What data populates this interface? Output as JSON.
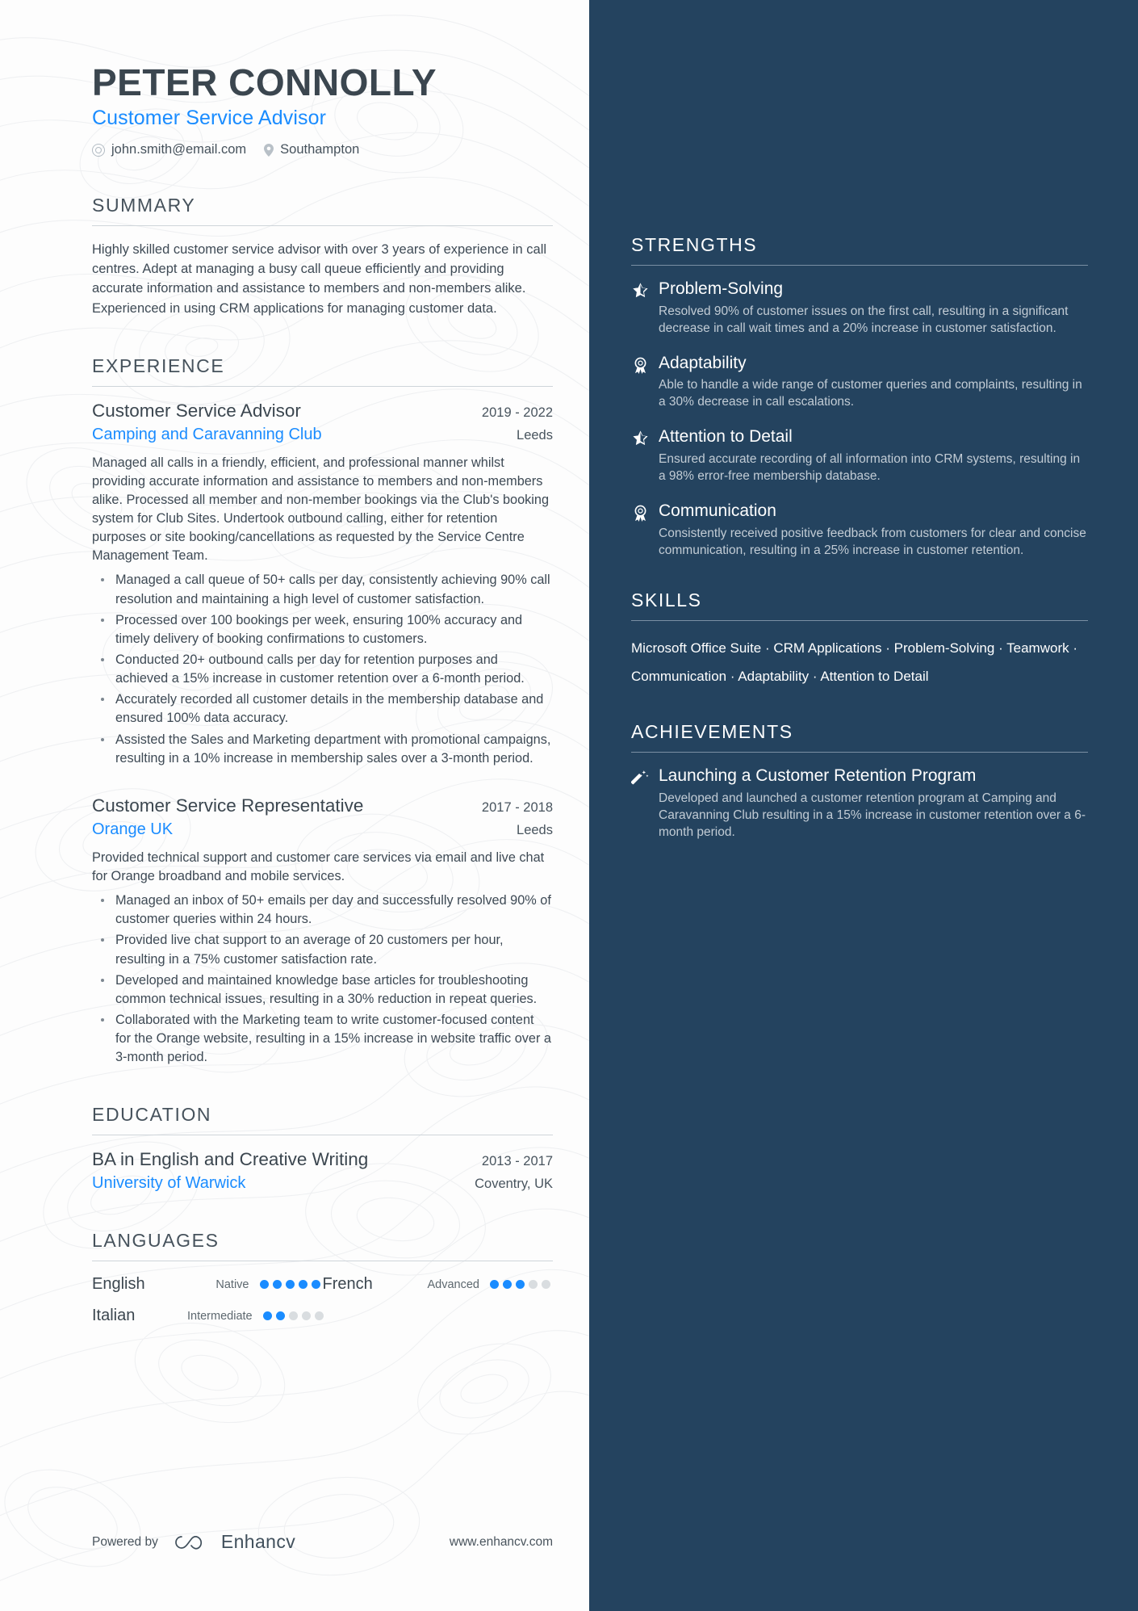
{
  "header": {
    "name": "PETER CONNOLLY",
    "role": "Customer Service Advisor",
    "email": "john.smith@email.com",
    "location": "Southampton",
    "email_icon": "at-icon",
    "location_icon": "map-pin-icon"
  },
  "colors": {
    "accent_blue": "#1a8cff",
    "sidebar_navy": "#24435f",
    "text_dark": "#3b464f"
  },
  "summary": {
    "heading": "SUMMARY",
    "text": "Highly skilled customer service advisor with over 3 years of experience in call centres. Adept at managing a busy call queue efficiently and providing accurate information and assistance to members and non-members alike. Experienced in using CRM applications for managing customer data."
  },
  "experience": {
    "heading": "EXPERIENCE",
    "jobs": [
      {
        "title": "Customer Service Advisor",
        "date": "2019 - 2022",
        "company": "Camping and Caravanning Club",
        "location": "Leeds",
        "description": "Managed all calls in a friendly, efficient, and professional manner whilst providing accurate information and assistance to members and non-members alike. Processed all member and non-member bookings via the Club's booking system for Club Sites. Undertook outbound calling, either for retention purposes or site booking/cancellations as requested by the Service Centre Management Team.",
        "bullets": [
          "Managed a call queue of 50+ calls per day, consistently achieving 90% call resolution and maintaining a high level of customer satisfaction.",
          "Processed over 100 bookings per week, ensuring 100% accuracy and timely delivery of booking confirmations to customers.",
          "Conducted 20+ outbound calls per day for retention purposes and achieved a 15% increase in customer retention over a 6-month period.",
          "Accurately recorded all customer details in the membership database and ensured 100% data accuracy.",
          "Assisted the Sales and Marketing department with promotional campaigns, resulting in a 10% increase in membership sales over a 3-month period."
        ]
      },
      {
        "title": "Customer Service Representative",
        "date": "2017 - 2018",
        "company": "Orange UK",
        "location": "Leeds",
        "description": "Provided technical support and customer care services via email and live chat for Orange broadband and mobile services.",
        "bullets": [
          "Managed an inbox of 50+ emails per day and successfully resolved 90% of customer queries within 24 hours.",
          "Provided live chat support to an average of 20 customers per hour, resulting in a 75% customer satisfaction rate.",
          "Developed and maintained knowledge base articles for troubleshooting common technical issues, resulting in a 30% reduction in repeat queries.",
          "Collaborated with the Marketing team to write customer-focused content for the Orange website, resulting in a 15% increase in website traffic over a 3-month period."
        ]
      }
    ]
  },
  "education": {
    "heading": "EDUCATION",
    "entries": [
      {
        "degree": "BA in English and Creative Writing",
        "date": "2013 - 2017",
        "school": "University of Warwick",
        "location": "Coventry, UK"
      }
    ]
  },
  "languages": {
    "heading": "LANGUAGES",
    "items": [
      {
        "name": "English",
        "level": "Native",
        "rating": 5,
        "max": 5
      },
      {
        "name": "French",
        "level": "Advanced",
        "rating": 3,
        "max": 5
      },
      {
        "name": "Italian",
        "level": "Intermediate",
        "rating": 2,
        "max": 5
      }
    ]
  },
  "footer": {
    "powered_by": "Powered by",
    "brand": "Enhancv",
    "brand_icon": "enhancv-infinity-logo",
    "website": "www.enhancv.com"
  },
  "strengths": {
    "heading": "STRENGTHS",
    "items": [
      {
        "icon": "shooting-star-icon",
        "title": "Problem-Solving",
        "description": "Resolved 90% of customer issues on the first call, resulting in a significant decrease in call wait times and a 20% increase in customer satisfaction."
      },
      {
        "icon": "award-ribbon-icon",
        "title": "Adaptability",
        "description": "Able to handle a wide range of customer queries and complaints, resulting in a 30% decrease in call escalations."
      },
      {
        "icon": "shooting-star-icon",
        "title": "Attention to Detail",
        "description": "Ensured accurate recording of all information into CRM systems, resulting in a 98% error-free membership database."
      },
      {
        "icon": "award-ribbon-icon",
        "title": "Communication",
        "description": "Consistently received positive feedback from customers for clear and concise communication, resulting in a 25% increase in customer retention."
      }
    ]
  },
  "skills": {
    "heading": "SKILLS",
    "text": "Microsoft Office Suite · CRM Applications · Problem-Solving · Teamwork · Communication · Adaptability · Attention to Detail"
  },
  "achievements": {
    "heading": "ACHIEVEMENTS",
    "items": [
      {
        "icon": "magic-wand-icon",
        "title": "Launching a Customer Retention Program",
        "description": "Developed and launched a customer retention program at Camping and Caravanning Club resulting in a 15% increase in customer retention over a 6-month period."
      }
    ]
  }
}
